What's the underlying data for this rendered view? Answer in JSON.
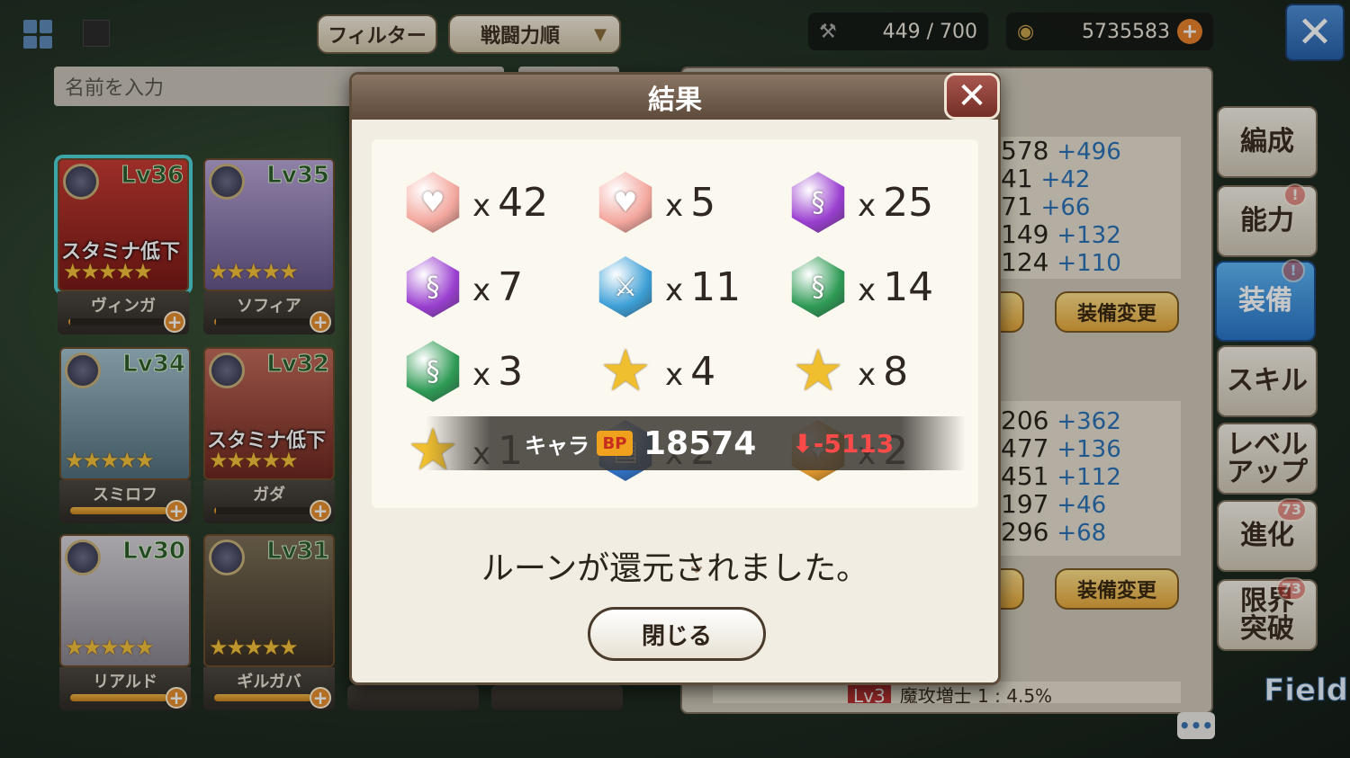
{
  "topbar": {
    "filter_label": "フィルター",
    "sort_label": "戦闘力順",
    "stamina": "449 / 700",
    "gold": "5735583"
  },
  "search": {
    "placeholder": "名前を入力"
  },
  "roster": [
    {
      "name": "ヴィンガ",
      "level": "Lv36",
      "status": "スタミナ低下",
      "stars": "★★★★★",
      "progress": 0.02
    },
    {
      "name": "ソフィア",
      "level": "Lv35",
      "status": "",
      "stars": "★★★★★",
      "progress": 0.02
    },
    {
      "name": "スミロフ",
      "level": "Lv34",
      "status": "",
      "stars": "★★★★★",
      "progress": 1.0
    },
    {
      "name": "ガダ",
      "level": "Lv32",
      "status": "スタミナ低下",
      "stars": "★★★★★",
      "progress": 0.02
    },
    {
      "name": "リアルド",
      "level": "Lv30",
      "status": "",
      "stars": "★★★★★",
      "progress": 1.0
    },
    {
      "name": "ギルガバ",
      "level": "Lv31",
      "status": "",
      "stars": "★★★★★",
      "progress": 1.0
    }
  ],
  "stats_top": [
    {
      "value": "578",
      "bonus": "+496"
    },
    {
      "value": "41",
      "bonus": "+42"
    },
    {
      "value": "71",
      "bonus": "+66"
    },
    {
      "value": "149",
      "bonus": "+132"
    },
    {
      "value": "124",
      "bonus": "+110"
    }
  ],
  "stats_bottom": [
    {
      "value": "206",
      "bonus": "+362"
    },
    {
      "value": "477",
      "bonus": "+136"
    },
    {
      "value": "451",
      "bonus": "+112"
    },
    {
      "value": "197",
      "bonus": "+46"
    },
    {
      "value": "296",
      "bonus": "+68"
    }
  ],
  "equip_change_label": "装備変更",
  "bottom_hint": "魔攻増士 1 : 4.5%",
  "bottom_hint_lv": "Lv3",
  "side_tabs": [
    {
      "label": "編成",
      "badge": ""
    },
    {
      "label": "能力",
      "badge": "!"
    },
    {
      "label": "装備",
      "badge": "!"
    },
    {
      "label": "スキル",
      "badge": ""
    },
    {
      "label": "レベル\nアップ",
      "badge": ""
    },
    {
      "label": "進化",
      "badge": "73"
    },
    {
      "label": "限界\n突破",
      "badge": "73"
    }
  ],
  "field_label": "Field",
  "chat_icon_text": "•••",
  "dialog": {
    "title": "結果",
    "rewards": [
      {
        "icon": "heart-rune-icon",
        "count": "42",
        "color": "#f3a79e"
      },
      {
        "icon": "heart-rune-icon",
        "count": "5",
        "color": "#f3a79e"
      },
      {
        "icon": "purple-rune-icon",
        "count": "25",
        "color": "#9a3fd0"
      },
      {
        "icon": "purple-rune-icon",
        "count": "7",
        "color": "#9a3fd0"
      },
      {
        "icon": "blue-rune-icon",
        "count": "11",
        "color": "#3d9fd6"
      },
      {
        "icon": "green-rune-icon",
        "count": "14",
        "color": "#2e9a55"
      },
      {
        "icon": "green-rune-icon",
        "count": "3",
        "color": "#2e9a55"
      },
      {
        "icon": "star-rune-icon",
        "count": "4",
        "color": "#f0bf2f"
      },
      {
        "icon": "star-rune-icon",
        "count": "8",
        "color": "#f0bf2f"
      },
      {
        "icon": "star-rune-icon",
        "count": "1",
        "color": "#f0bf2f"
      },
      {
        "icon": "book-rune-icon",
        "count": "2",
        "color": "#2f73c9"
      },
      {
        "icon": "orange-rune-icon",
        "count": "2",
        "color": "#e39a2d"
      }
    ],
    "bp_toast": {
      "label": "キャラ",
      "bp_icon": "BP",
      "value": "18574",
      "change": "-5113"
    },
    "message": "ルーンが還元されました。",
    "close_label": "閉じる"
  }
}
